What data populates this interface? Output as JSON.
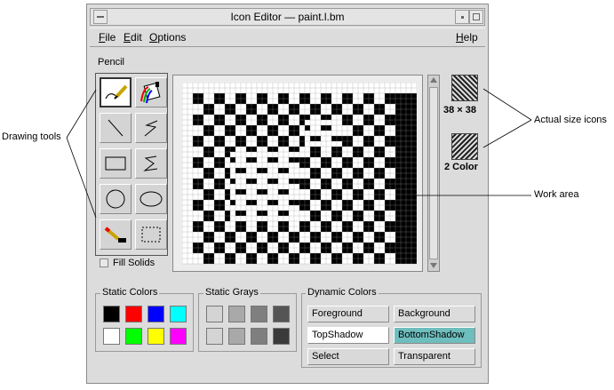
{
  "window": {
    "title": "Icon Editor — paint.l.bm"
  },
  "menubar": {
    "items": [
      {
        "label": "File"
      },
      {
        "label": "Edit"
      },
      {
        "label": "Options"
      }
    ],
    "help_label": "Help"
  },
  "tools": {
    "current_label": "Pencil",
    "items": [
      {
        "name": "pencil-icon",
        "selected": true
      },
      {
        "name": "flood-fill-icon",
        "selected": false
      },
      {
        "name": "line-icon",
        "selected": false
      },
      {
        "name": "polyline-icon",
        "selected": false
      },
      {
        "name": "rectangle-icon",
        "selected": false
      },
      {
        "name": "polygon-icon",
        "selected": false
      },
      {
        "name": "circle-icon",
        "selected": false
      },
      {
        "name": "ellipse-icon",
        "selected": false
      },
      {
        "name": "eraser-icon",
        "selected": false
      },
      {
        "name": "select-area-icon",
        "selected": false
      }
    ],
    "fill_solids_label": "Fill Solids"
  },
  "previews": [
    {
      "label": "38 × 38"
    },
    {
      "label": "2 Color"
    }
  ],
  "static_colors": {
    "label": "Static Colors",
    "swatches": [
      "#000000",
      "#ff0000",
      "#0000ff",
      "#00ffff",
      "#ffffff",
      "#00ff00",
      "#ffff00",
      "#ff00ff"
    ]
  },
  "static_grays": {
    "label": "Static Grays",
    "swatches": [
      "#d4d4d4",
      "#a9a9a9",
      "#7f7f7f",
      "#555555",
      "#d4d4d4",
      "#a9a9a9",
      "#7f7f7f",
      "#3a3a3a"
    ]
  },
  "dynamic_colors": {
    "label": "Dynamic Colors",
    "buttons": [
      {
        "label": "Foreground",
        "bg": "#dcdcdc"
      },
      {
        "label": "Background",
        "bg": "#dcdcdc"
      },
      {
        "label": "TopShadow",
        "bg": "#ffffff"
      },
      {
        "label": "BottomShadow",
        "bg": "#6fbebe"
      },
      {
        "label": "Select",
        "bg": "#d9d9d9"
      },
      {
        "label": "Transparent",
        "bg": "#dcdcdc"
      }
    ]
  },
  "callouts": {
    "drawing_tools": "Drawing tools",
    "actual_size": "Actual size icons",
    "work_area": "Work area"
  }
}
